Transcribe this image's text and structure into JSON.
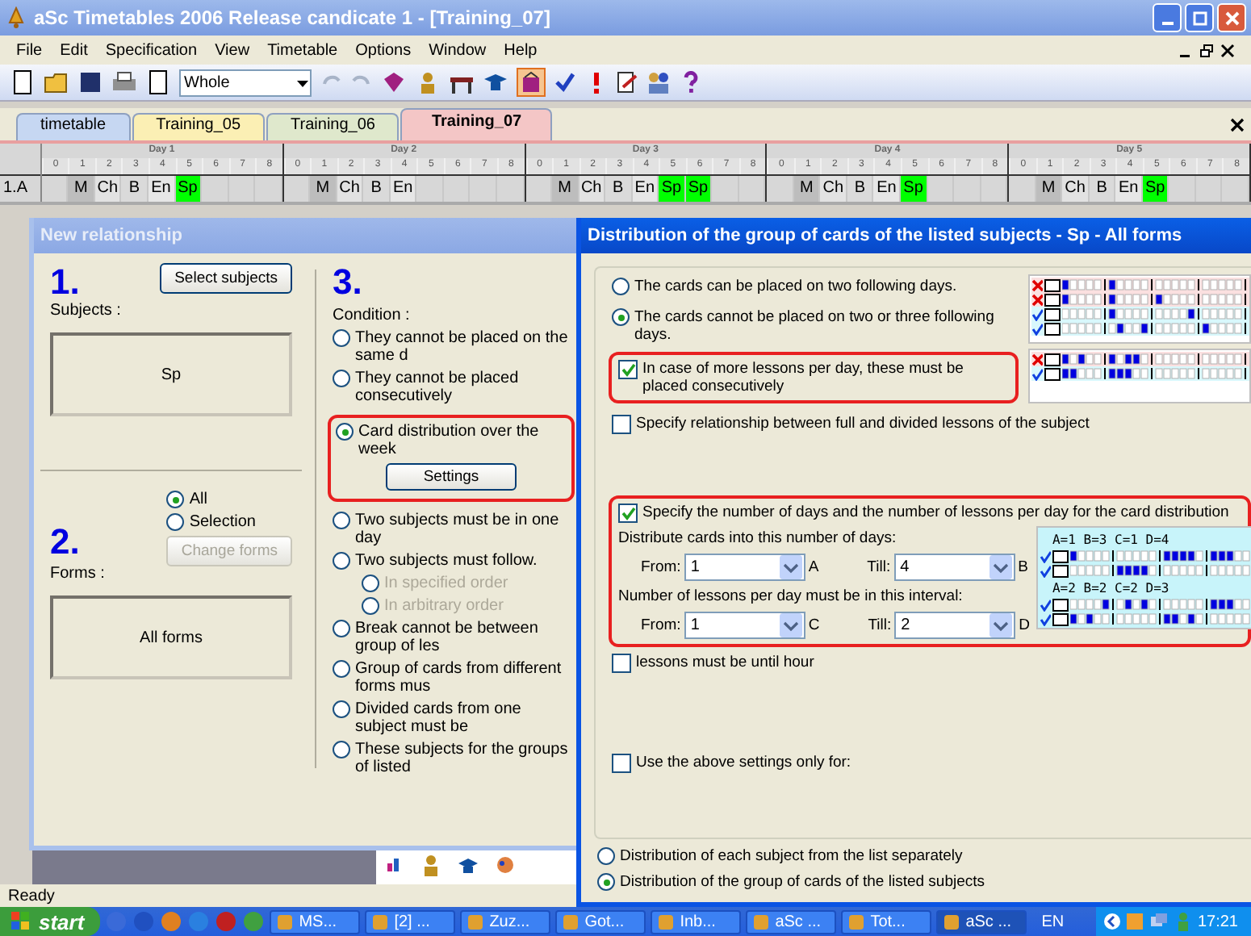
{
  "window": {
    "title": "aSc Timetables 2006 Release candicate 1 - [Training_07]"
  },
  "menu": [
    "File",
    "Edit",
    "Specification",
    "View",
    "Timetable",
    "Options",
    "Window",
    "Help"
  ],
  "toolbar": {
    "view_select": "Whole"
  },
  "tabs": [
    {
      "label": "timetable",
      "selected": false,
      "color": "#c6d7f2"
    },
    {
      "label": "Training_05",
      "selected": false,
      "color": "#fbefb4"
    },
    {
      "label": "Training_06",
      "selected": false,
      "color": "#dfe8cc"
    },
    {
      "label": "Training_07",
      "selected": true,
      "color": "#f4c6c6"
    }
  ],
  "timetable": {
    "row_label": "1.A",
    "days": [
      {
        "name": "Day 1",
        "periods": [
          "0",
          "1",
          "2",
          "3",
          "4",
          "5",
          "6",
          "7",
          "8"
        ],
        "lessons": [
          {
            "text": "M",
            "color": "#bdbdbd"
          },
          {
            "text": "Ch",
            "color": "#e2e2e2"
          },
          {
            "text": "B",
            "color": "#dadada"
          },
          {
            "text": "En",
            "color": "#e6e6e6"
          },
          {
            "text": "Sp",
            "color": "#00ff00"
          }
        ]
      },
      {
        "name": "Day 2",
        "periods": [
          "0",
          "1",
          "2",
          "3",
          "4",
          "5",
          "6",
          "7",
          "8"
        ],
        "lessons": [
          {
            "text": "M",
            "color": "#bdbdbd"
          },
          {
            "text": "Ch",
            "color": "#e2e2e2"
          },
          {
            "text": "B",
            "color": "#dadada"
          },
          {
            "text": "En",
            "color": "#e6e6e6"
          }
        ]
      },
      {
        "name": "Day 3",
        "periods": [
          "0",
          "1",
          "2",
          "3",
          "4",
          "5",
          "6",
          "7",
          "8"
        ],
        "lessons": [
          {
            "text": "M",
            "color": "#bdbdbd"
          },
          {
            "text": "Ch",
            "color": "#e2e2e2"
          },
          {
            "text": "B",
            "color": "#dadada"
          },
          {
            "text": "En",
            "color": "#e6e6e6"
          },
          {
            "text": "Sp",
            "color": "#00ff00"
          },
          {
            "text": "Sp",
            "color": "#00ff00"
          }
        ]
      },
      {
        "name": "Day 4",
        "periods": [
          "0",
          "1",
          "2",
          "3",
          "4",
          "5",
          "6",
          "7",
          "8"
        ],
        "lessons": [
          {
            "text": "M",
            "color": "#bdbdbd"
          },
          {
            "text": "Ch",
            "color": "#e2e2e2"
          },
          {
            "text": "B",
            "color": "#dadada"
          },
          {
            "text": "En",
            "color": "#e6e6e6"
          },
          {
            "text": "Sp",
            "color": "#00ff00"
          }
        ]
      },
      {
        "name": "Day 5",
        "periods": [
          "0",
          "1",
          "2",
          "3",
          "4",
          "5",
          "6",
          "7",
          "8"
        ],
        "lessons": [
          {
            "text": "M",
            "color": "#bdbdbd"
          },
          {
            "text": "Ch",
            "color": "#e2e2e2"
          },
          {
            "text": "B",
            "color": "#dadada"
          },
          {
            "text": "En",
            "color": "#e6e6e6"
          },
          {
            "text": "Sp",
            "color": "#00ff00"
          }
        ]
      }
    ]
  },
  "relationship_dialog": {
    "title": "New relationship",
    "step1": "1.",
    "select_button": "Select subjects",
    "subjects_label": "Subjects :",
    "subjects": "Sp",
    "step2": "2.",
    "forms_options": [
      {
        "label": "All",
        "selected": true
      },
      {
        "label": "Selection",
        "selected": false
      }
    ],
    "forms_label": "Forms :",
    "change_forms_button": {
      "label": "Change forms",
      "disabled": true
    },
    "forms": "All forms",
    "step3": "3.",
    "condition_label": "Condition :",
    "conditions": [
      {
        "label": "They cannot be placed on the same d",
        "selected": false,
        "highlighted": false
      },
      {
        "label": "They cannot be placed consecutively",
        "selected": false,
        "highlighted": false
      },
      {
        "label": "Card distribution over the week",
        "selected": true,
        "highlighted": true,
        "button": "Settings"
      },
      {
        "label": "Two subjects must be in one day",
        "selected": false,
        "highlighted": false
      },
      {
        "label": "Two subjects must follow.",
        "selected": false,
        "highlighted": false,
        "children": [
          {
            "label": "In specified order",
            "selected": false,
            "disabled": true
          },
          {
            "label": "In arbitrary order",
            "selected": false,
            "disabled": true
          }
        ]
      },
      {
        "label": "Break cannot be between group of les",
        "selected": false,
        "highlighted": false
      },
      {
        "label": "Group of cards from different forms mus",
        "selected": false,
        "highlighted": false
      },
      {
        "label": "Divided cards from one subject must be",
        "selected": false,
        "highlighted": false
      },
      {
        "label": "These subjects for the groups of listed",
        "selected": false,
        "highlighted": false
      }
    ]
  },
  "distribution_dialog": {
    "title": "Distribution of the group of cards of the listed subjects - Sp - All forms",
    "placement_options": [
      {
        "label": "The cards can be placed on two following days.",
        "selected": false
      },
      {
        "label": "The cards cannot be placed on two or three following days.",
        "selected": true
      }
    ],
    "examples_1": [
      {
        "valid": false,
        "days": [
          [
            true,
            false,
            false,
            false,
            false
          ],
          [
            true,
            false,
            false,
            false,
            false
          ],
          [
            false,
            false,
            false,
            false,
            false
          ],
          [
            false,
            false,
            false,
            false,
            false
          ]
        ]
      },
      {
        "valid": false,
        "days": [
          [
            true,
            false,
            false,
            false,
            false
          ],
          [
            true,
            false,
            false,
            false,
            false
          ],
          [
            true,
            false,
            false,
            false,
            false
          ],
          [
            false,
            false,
            false,
            false,
            false
          ]
        ]
      },
      {
        "valid": true,
        "days": [
          [
            false,
            false,
            false,
            false,
            false
          ],
          [
            true,
            false,
            false,
            false,
            false
          ],
          [
            false,
            false,
            false,
            false,
            true
          ],
          [
            false,
            false,
            false,
            false,
            false
          ]
        ]
      },
      {
        "valid": true,
        "days": [
          [
            false,
            false,
            false,
            false,
            false
          ],
          [
            false,
            true,
            false,
            false,
            true
          ],
          [
            false,
            false,
            false,
            false,
            false
          ],
          [
            true,
            false,
            false,
            false,
            false
          ]
        ]
      }
    ],
    "consecutive": {
      "label": "In case of more lessons per day, these must be placed consecutively",
      "checked": true,
      "highlighted": true
    },
    "examples_2": [
      {
        "valid": false,
        "days": [
          [
            true,
            false,
            true,
            false,
            false
          ],
          [
            true,
            false,
            true,
            true,
            false
          ],
          [
            false,
            false,
            false,
            false,
            false
          ],
          [
            false,
            false,
            false,
            false,
            false
          ]
        ]
      },
      {
        "valid": true,
        "days": [
          [
            true,
            true,
            false,
            false,
            false
          ],
          [
            true,
            true,
            true,
            false,
            false
          ],
          [
            false,
            false,
            false,
            false,
            false
          ],
          [
            false,
            false,
            false,
            false,
            false
          ]
        ]
      }
    ],
    "relationship": {
      "label": "Specify relationship between full and divided lessons of the subject",
      "checked": false
    },
    "count": {
      "label": "Specify the number of days and the number of lessons per day for the card distribution",
      "checked": true,
      "highlighted": true,
      "days_label": "Distribute cards into this number of days:",
      "days_from": {
        "label": "From:",
        "value": "1",
        "letter": "A"
      },
      "days_till": {
        "label": "Till:",
        "value": "4",
        "letter": "B"
      },
      "lessons_label": "Number of lessons per day must be in this interval:",
      "lessons_from": {
        "label": "From:",
        "value": "1",
        "letter": "C"
      },
      "lessons_till": {
        "label": "Till:",
        "value": "2",
        "letter": "D"
      }
    },
    "examples_3": [
      {
        "caption": "A=1 B=3 C=1 D=4",
        "rows": [
          {
            "valid": true,
            "days": [
              [
                true,
                false,
                false,
                false,
                false
              ],
              [
                false,
                false,
                false,
                false,
                false
              ],
              [
                true,
                true,
                true,
                true,
                false
              ],
              [
                true,
                true,
                true,
                false,
                false
              ]
            ]
          },
          {
            "valid": true,
            "days": [
              [
                false,
                false,
                false,
                false,
                false
              ],
              [
                true,
                true,
                true,
                true,
                false
              ],
              [
                false,
                false,
                false,
                false,
                false
              ],
              [
                false,
                false,
                false,
                false,
                false
              ]
            ]
          }
        ]
      },
      {
        "caption": "A=2 B=2 C=2 D=3",
        "rows": [
          {
            "valid": true,
            "days": [
              [
                false,
                false,
                false,
                false,
                true
              ],
              [
                false,
                true,
                false,
                true,
                false
              ],
              [
                false,
                false,
                false,
                false,
                false
              ],
              [
                true,
                true,
                true,
                false,
                false
              ]
            ]
          },
          {
            "valid": true,
            "days": [
              [
                true,
                false,
                true,
                false,
                false
              ],
              [
                false,
                false,
                false,
                false,
                false
              ],
              [
                true,
                true,
                false,
                true,
                false
              ],
              [
                false,
                false,
                false,
                false,
                false
              ]
            ]
          }
        ]
      }
    ],
    "until_hour": {
      "label": "lessons must be until hour",
      "checked": false
    },
    "only_for": {
      "label": "Use the above settings only for:",
      "checked": false
    },
    "scope_options": [
      {
        "label": "Distribution of each subject from the list separately",
        "selected": false
      },
      {
        "label": "Distribution of the group of cards of the listed subjects",
        "selected": true
      }
    ]
  },
  "status_bar": "Ready",
  "taskbar": {
    "start": "start",
    "tasks": [
      {
        "label": "MS...",
        "selected": false
      },
      {
        "label": "[2] ...",
        "selected": false
      },
      {
        "label": "Zuz...",
        "selected": false
      },
      {
        "label": "Got...",
        "selected": false
      },
      {
        "label": "Inb...",
        "selected": false
      },
      {
        "label": "aSc ...",
        "selected": false
      },
      {
        "label": "Tot...",
        "selected": false
      },
      {
        "label": "aSc ...",
        "selected": true
      }
    ],
    "language": "EN",
    "clock": "17:21"
  }
}
